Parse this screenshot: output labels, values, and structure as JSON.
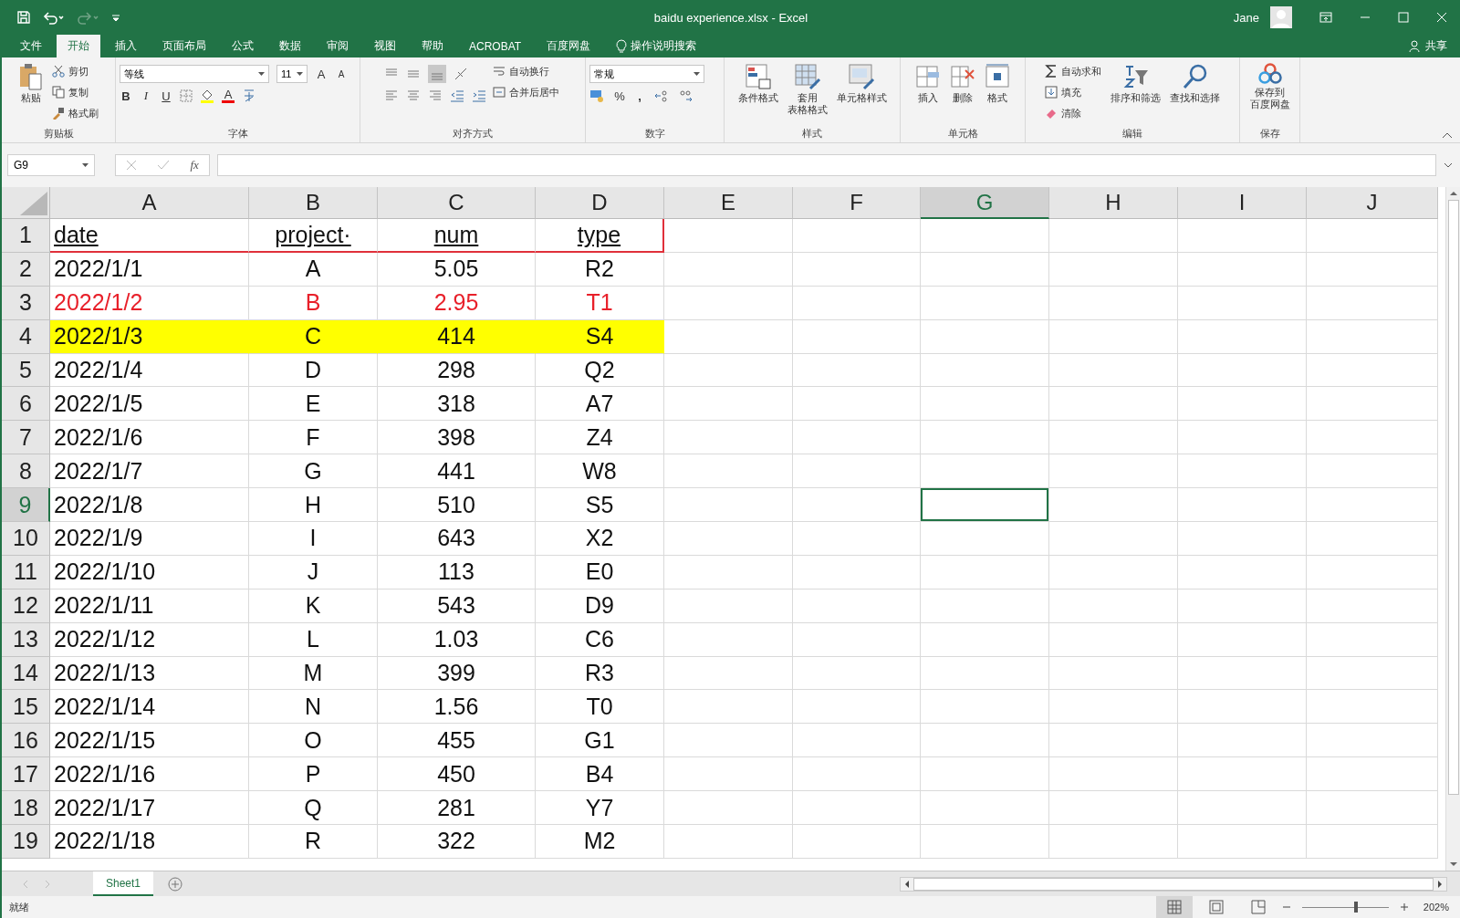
{
  "window": {
    "title": "baidu experience.xlsx  -  Excel",
    "user": "Jane"
  },
  "ribbon_tabs": [
    {
      "label": "文件",
      "selected": false
    },
    {
      "label": "开始",
      "selected": true
    },
    {
      "label": "插入",
      "selected": false
    },
    {
      "label": "页面布局",
      "selected": false
    },
    {
      "label": "公式",
      "selected": false
    },
    {
      "label": "数据",
      "selected": false
    },
    {
      "label": "审阅",
      "selected": false
    },
    {
      "label": "视图",
      "selected": false
    },
    {
      "label": "帮助",
      "selected": false
    },
    {
      "label": "ACROBAT",
      "selected": false
    },
    {
      "label": "百度网盘",
      "selected": false
    }
  ],
  "tell_me": "操作说明搜索",
  "share": "共享",
  "ribbon": {
    "clipboard": {
      "label": "剪贴板",
      "paste": "粘贴",
      "cut": "剪切",
      "copy": "复制",
      "format_painter": "格式刷"
    },
    "font": {
      "label": "字体",
      "font_name": "等线",
      "font_size": "11",
      "grow": "A",
      "shrink": "A",
      "bold": "B",
      "italic": "I",
      "underline": "U",
      "font_color": "A"
    },
    "alignment": {
      "label": "对齐方式",
      "wrap": "自动换行",
      "merge": "合并后居中"
    },
    "number": {
      "label": "数字",
      "format": "常规",
      "percent": "%",
      "comma": ","
    },
    "styles": {
      "label": "样式",
      "conditional": "条件格式",
      "table_l1": "套用",
      "table_l2": "表格格式",
      "cell_styles": "单元格样式"
    },
    "cells": {
      "label": "单元格",
      "insert": "插入",
      "delete": "删除",
      "format": "格式"
    },
    "editing": {
      "label": "编辑",
      "autosum": "自动求和",
      "fill": "填充",
      "clear": "清除",
      "sort": "排序和筛选",
      "find": "查找和选择"
    },
    "save": {
      "label": "保存",
      "l1": "保存到",
      "l2": "百度网盘"
    }
  },
  "formula_bar": {
    "name_box": "G9",
    "fx": "fx"
  },
  "sheet": {
    "columns": [
      {
        "label": "A",
        "selected": false
      },
      {
        "label": "B",
        "selected": false
      },
      {
        "label": "C",
        "selected": false
      },
      {
        "label": "D",
        "selected": false
      },
      {
        "label": "E",
        "selected": false
      },
      {
        "label": "F",
        "selected": false
      },
      {
        "label": "G",
        "selected": true
      },
      {
        "label": "H",
        "selected": false
      },
      {
        "label": "I",
        "selected": false
      },
      {
        "label": "J",
        "selected": false
      }
    ],
    "rows": [
      {
        "number": "1",
        "selected": false,
        "kind": "header",
        "cells": [
          "date",
          "project·",
          "num",
          "type"
        ]
      },
      {
        "number": "2",
        "selected": false,
        "kind": "normal",
        "cells": [
          "2022/1/1",
          "A",
          "5.05",
          "R2"
        ]
      },
      {
        "number": "3",
        "selected": false,
        "kind": "red",
        "cells": [
          "2022/1/2",
          "B",
          "2.95",
          "T1"
        ]
      },
      {
        "number": "4",
        "selected": false,
        "kind": "highlight",
        "cells": [
          "2022/1/3",
          "C",
          "414",
          "S4"
        ]
      },
      {
        "number": "5",
        "selected": false,
        "kind": "normal",
        "cells": [
          "2022/1/4",
          "D",
          "298",
          "Q2"
        ]
      },
      {
        "number": "6",
        "selected": false,
        "kind": "normal",
        "cells": [
          "2022/1/5",
          "E",
          "318",
          "A7"
        ]
      },
      {
        "number": "7",
        "selected": false,
        "kind": "normal",
        "cells": [
          "2022/1/6",
          "F",
          "398",
          "Z4"
        ]
      },
      {
        "number": "8",
        "selected": false,
        "kind": "normal",
        "cells": [
          "2022/1/7",
          "G",
          "441",
          "W8"
        ]
      },
      {
        "number": "9",
        "selected": true,
        "kind": "normal",
        "cells": [
          "2022/1/8",
          "H",
          "510",
          "S5"
        ]
      },
      {
        "number": "10",
        "selected": false,
        "kind": "normal",
        "cells": [
          "2022/1/9",
          "I",
          "643",
          "X2"
        ]
      },
      {
        "number": "11",
        "selected": false,
        "kind": "normal",
        "cells": [
          "2022/1/10",
          "J",
          "113",
          "E0"
        ]
      },
      {
        "number": "12",
        "selected": false,
        "kind": "normal",
        "cells": [
          "2022/1/11",
          "K",
          "543",
          "D9"
        ]
      },
      {
        "number": "13",
        "selected": false,
        "kind": "normal",
        "cells": [
          "2022/1/12",
          "L",
          "1.03",
          "C6"
        ]
      },
      {
        "number": "14",
        "selected": false,
        "kind": "normal",
        "cells": [
          "2022/1/13",
          "M",
          "399",
          "R3"
        ]
      },
      {
        "number": "15",
        "selected": false,
        "kind": "normal",
        "cells": [
          "2022/1/14",
          "N",
          "1.56",
          "T0"
        ]
      },
      {
        "number": "16",
        "selected": false,
        "kind": "normal",
        "cells": [
          "2022/1/15",
          "O",
          "455",
          "G1"
        ]
      },
      {
        "number": "17",
        "selected": false,
        "kind": "normal",
        "cells": [
          "2022/1/16",
          "P",
          "450",
          "B4"
        ]
      },
      {
        "number": "18",
        "selected": false,
        "kind": "normal",
        "cells": [
          "2022/1/17",
          "Q",
          "281",
          "Y7"
        ]
      },
      {
        "number": "19",
        "selected": false,
        "kind": "normal",
        "cells": [
          "2022/1/18",
          "R",
          "322",
          "M2"
        ]
      }
    ]
  },
  "sheet_tabs": [
    {
      "label": "Sheet1",
      "selected": true
    }
  ],
  "status_bar": {
    "status": "就绪",
    "zoom": "202%",
    "zoom_level": {
      "level": 0.63
    }
  }
}
